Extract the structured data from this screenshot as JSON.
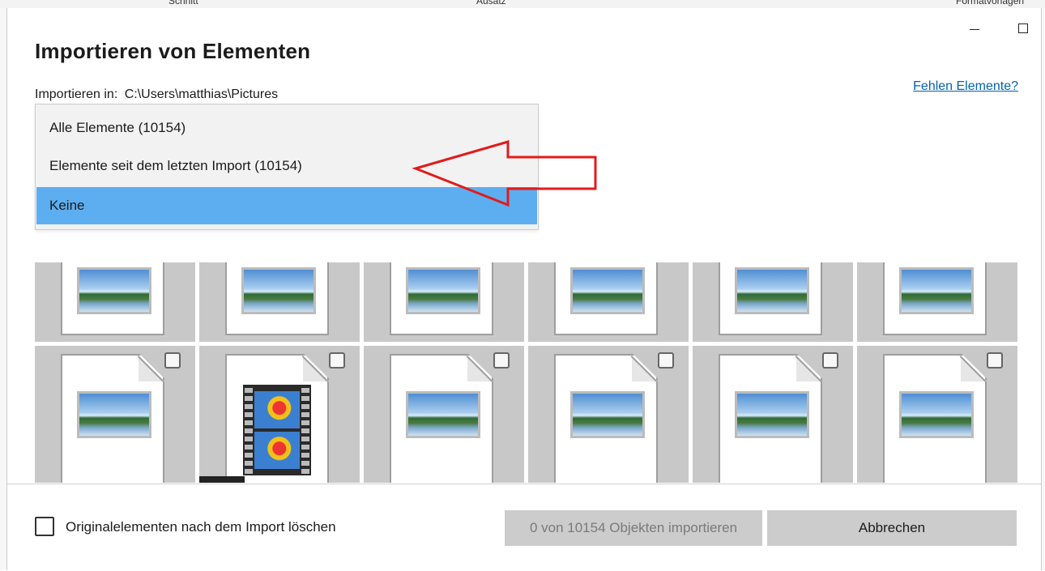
{
  "background": {
    "fragments": [
      "Schnitt",
      "Ausatz",
      "Formatvorlagen"
    ]
  },
  "dialog": {
    "title": "Importieren von Elementen",
    "import_in_label": "Importieren in:",
    "import_in_path": "C:\\Users\\matthias\\Pictures",
    "missing_link": "Fehlen Elemente?",
    "window_controls": [
      "minimize-icon",
      "maximize-icon"
    ]
  },
  "dropdown": {
    "options": [
      "Alle Elemente (10154)",
      "Elemente seit dem letzten Import (10154)",
      "Keine"
    ],
    "selected": "Keine",
    "highlight_color": "#5daef0"
  },
  "annotation": {
    "arrow_color": "#e21b1b"
  },
  "thumbnails": {
    "row1_icons": [
      "image-file-icon",
      "image-file-icon",
      "image-file-icon",
      "image-file-icon",
      "image-file-icon",
      "image-file-icon"
    ],
    "row2_icons": [
      "image-file-icon",
      "video-file-icon",
      "image-file-icon",
      "image-file-icon",
      "image-file-icon",
      "image-file-icon"
    ]
  },
  "footer": {
    "delete_originals_label": "Originalelementen nach dem Import löschen",
    "delete_originals_checked": false,
    "import_button": "0 von 10154 Objekten importieren",
    "cancel_button": "Abbrechen"
  }
}
